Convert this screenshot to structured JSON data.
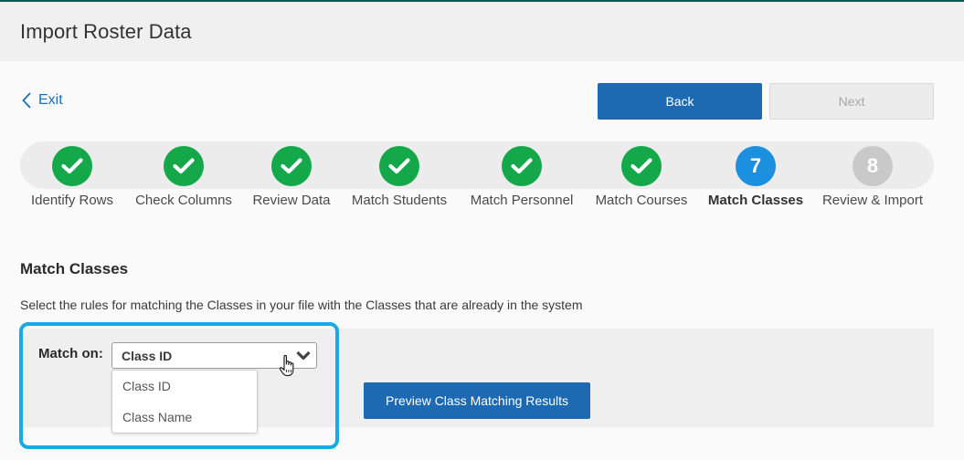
{
  "header": {
    "title": "Import Roster Data"
  },
  "nav": {
    "exit_label": "Exit",
    "back_label": "Back",
    "next_label": "Next"
  },
  "steps": [
    {
      "label": "Identify Rows",
      "status": "done"
    },
    {
      "label": "Check Columns",
      "status": "done"
    },
    {
      "label": "Review Data",
      "status": "done"
    },
    {
      "label": "Match Students",
      "status": "done"
    },
    {
      "label": "Match Personnel",
      "status": "done"
    },
    {
      "label": "Match Courses",
      "status": "done"
    },
    {
      "label": "Match Classes",
      "status": "current",
      "number": "7"
    },
    {
      "label": "Review & Import",
      "status": "future",
      "number": "8"
    }
  ],
  "section": {
    "title": "Match Classes",
    "description": "Select the rules for matching the Classes in your file with the Classes that are already in the system"
  },
  "match": {
    "label": "Match on:",
    "selected": "Class ID",
    "options": [
      "Class ID",
      "Class Name"
    ]
  },
  "preview_button": "Preview Class Matching Results",
  "colors": {
    "primary": "#1d6ab2",
    "step_done": "#14a84a",
    "step_current": "#1d8fdf",
    "step_future": "#c9c9c9",
    "highlight": "#19a9e5",
    "link": "#1a6fb5"
  },
  "icons": {
    "exit": "chevron-left-icon",
    "done_step": "check-icon",
    "select": "chevron-down-icon",
    "cursor": "hand-pointer-icon"
  }
}
